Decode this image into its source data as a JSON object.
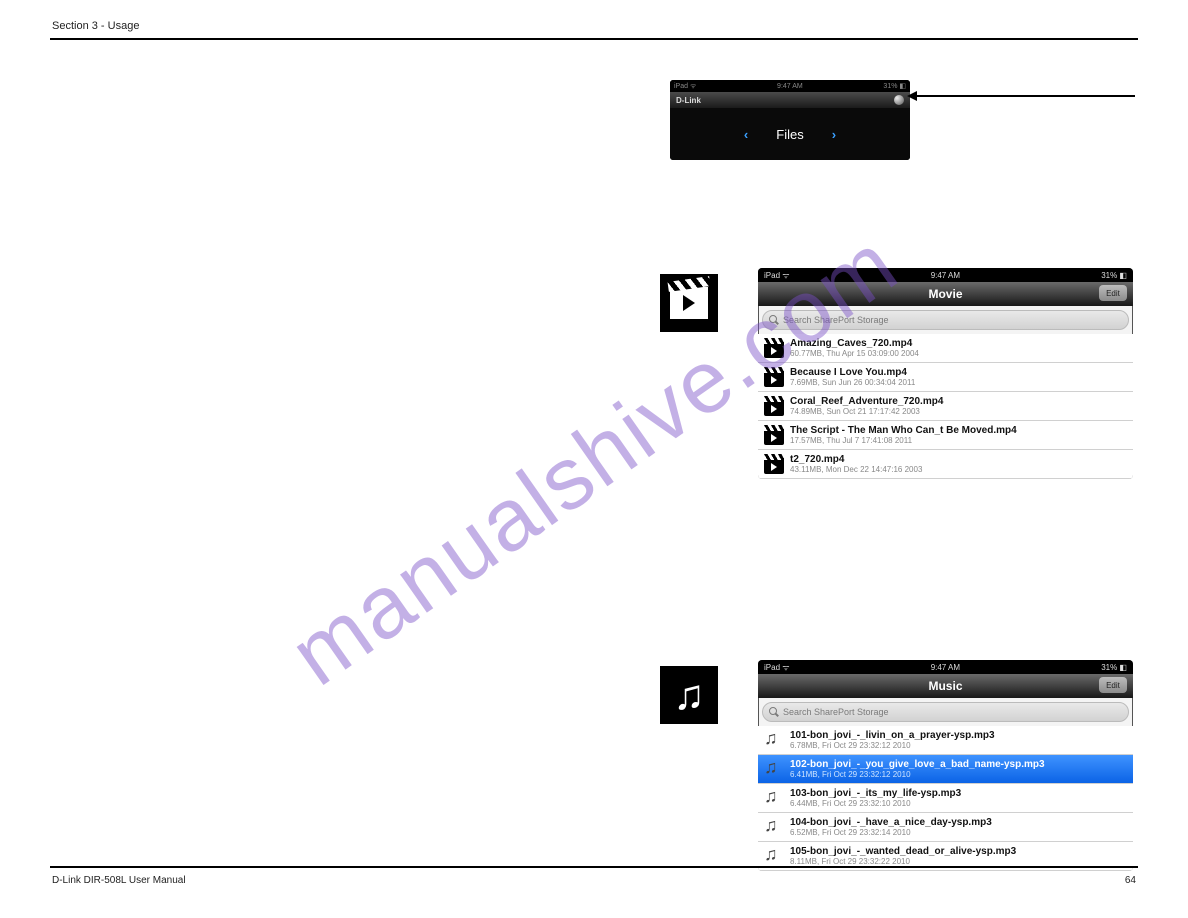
{
  "header": {
    "section": "Section 3 - Usage"
  },
  "watermark": "manualshive.com",
  "footer": {
    "left": "D-Link DIR-508L User Manual",
    "page": "64"
  },
  "filesbar": {
    "status_left": "iPad  ᯤ",
    "status_center": "9:47 AM",
    "status_right": "31%  ◧",
    "brand": "D-Link",
    "gear": "settings-gear",
    "nav_prev": "‹",
    "nav_label": "Files",
    "nav_next": "›"
  },
  "movie": {
    "status_left": "iPad  ᯤ",
    "status_center": "9:47 AM",
    "status_right": "31%  ◧",
    "title": "Movie",
    "edit": "Edit",
    "search_placeholder": "Search SharePort Storage",
    "items": [
      {
        "name": "Amazing_Caves_720.mp4",
        "meta": "60.77MB, Thu Apr 15 03:09:00 2004"
      },
      {
        "name": "Because I Love You.mp4",
        "meta": "7.69MB, Sun Jun 26 00:34:04 2011"
      },
      {
        "name": "Coral_Reef_Adventure_720.mp4",
        "meta": "74.89MB, Sun Oct 21 17:17:42 2003"
      },
      {
        "name": "The Script - The Man Who Can_t Be Moved.mp4",
        "meta": "17.57MB, Thu Jul 7 17:41:08 2011"
      },
      {
        "name": "t2_720.mp4",
        "meta": "43.11MB, Mon Dec 22 14:47:16 2003"
      }
    ]
  },
  "music": {
    "status_left": "iPad  ᯤ",
    "status_center": "9:47 AM",
    "status_right": "31%  ◧",
    "title": "Music",
    "edit": "Edit",
    "search_placeholder": "Search SharePort Storage",
    "items": [
      {
        "name": "101-bon_jovi_-_livin_on_a_prayer-ysp.mp3",
        "meta": "6.78MB, Fri Oct 29 23:32:12 2010",
        "selected": false
      },
      {
        "name": "102-bon_jovi_-_you_give_love_a_bad_name-ysp.mp3",
        "meta": "6.41MB, Fri Oct 29 23:32:12 2010",
        "selected": true
      },
      {
        "name": "103-bon_jovi_-_its_my_life-ysp.mp3",
        "meta": "6.44MB, Fri Oct 29 23:32:10 2010",
        "selected": false
      },
      {
        "name": "104-bon_jovi_-_have_a_nice_day-ysp.mp3",
        "meta": "6.52MB, Fri Oct 29 23:32:14 2010",
        "selected": false
      },
      {
        "name": "105-bon_jovi_-_wanted_dead_or_alive-ysp.mp3",
        "meta": "8.11MB, Fri Oct 29 23:32:22 2010",
        "selected": false
      }
    ]
  }
}
